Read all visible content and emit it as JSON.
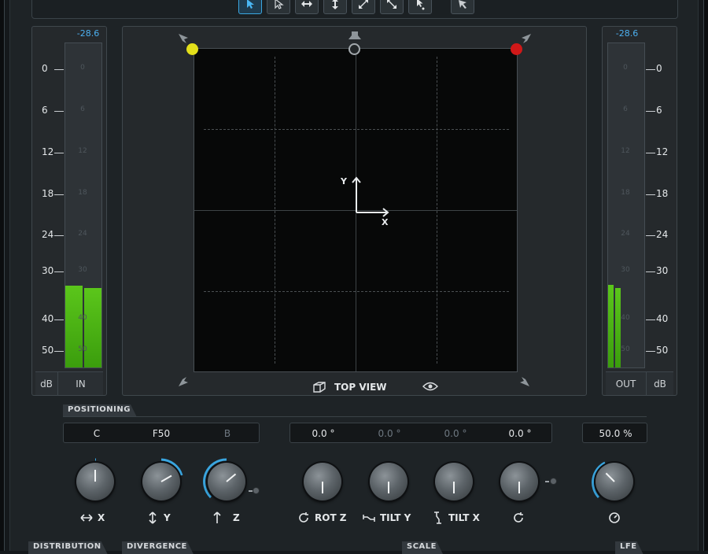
{
  "toolbar": {
    "tools": [
      {
        "icon": "select-arrow-icon",
        "active": true
      },
      {
        "icon": "select-outline-arrow-icon",
        "active": false
      },
      {
        "icon": "move-horizontal-icon",
        "active": false
      },
      {
        "icon": "move-vertical-icon",
        "active": false
      },
      {
        "icon": "move-diagonal-icon",
        "active": false
      },
      {
        "icon": "move-antidiagonal-icon",
        "active": false
      },
      {
        "icon": "pointer-dot-icon",
        "active": false
      },
      {
        "icon": "speaker-pointer-icon",
        "active": false
      }
    ]
  },
  "input_meter": {
    "peak": "-28.6",
    "scale": [
      "0",
      "6",
      "12",
      "18",
      "24",
      "30",
      "40",
      "50"
    ],
    "unit_label": "dB",
    "channel_label": "IN",
    "levels": [
      0.252,
      0.246
    ]
  },
  "output_meter": {
    "peak": "-28.6",
    "scale": [
      "0",
      "6",
      "12",
      "18",
      "24",
      "30",
      "40",
      "50"
    ],
    "unit_label": "dB",
    "channel_label": "OUT",
    "levels": [
      0.254,
      0.246
    ]
  },
  "view": {
    "label": "TOP VIEW",
    "y_axis_label": "Y",
    "x_axis_label": "X",
    "speakers": [
      {
        "name": "left-speaker",
        "color": "#e3df1a"
      },
      {
        "name": "center-speaker",
        "color": "#222628"
      },
      {
        "name": "right-speaker",
        "color": "#d01818"
      }
    ]
  },
  "positioning": {
    "section_label": "POSITIONING",
    "channel_values": [
      "C",
      "F50",
      "B"
    ],
    "rotation_values": [
      "0.0 °",
      "0.0 °",
      "0.0 °",
      "0.0 °"
    ],
    "percent_value": "50.0 %",
    "knobs": [
      {
        "label": "X",
        "icon": "arrows-horizontal-icon"
      },
      {
        "label": "Y",
        "icon": "arrows-vertical-icon"
      },
      {
        "label": "Z",
        "icon": "arrow-up-icon"
      },
      {
        "label": "ROT Z",
        "icon": "rotate-icon"
      },
      {
        "label": "TILT Y",
        "icon": "tilt-y-icon"
      },
      {
        "label": "TILT X",
        "icon": "tilt-x-icon"
      },
      {
        "label": "",
        "icon": "rotate-cw-icon"
      },
      {
        "label": "",
        "icon": "dial-icon"
      }
    ]
  },
  "bottom_sections": [
    "DISTRIBUTION",
    "DIVERGENCE",
    "SCALE",
    "LFE"
  ],
  "colors": {
    "accent": "#3aa6e0",
    "meter_green": "#4fb618",
    "background": "#1e2326"
  }
}
